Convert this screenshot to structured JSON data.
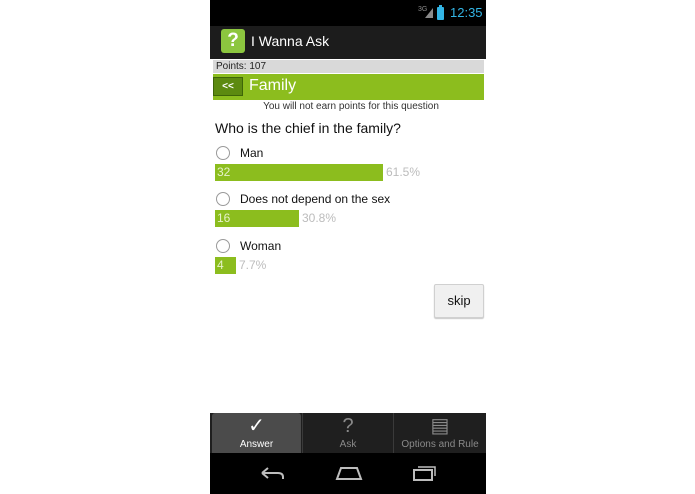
{
  "status_bar": {
    "network": "3G",
    "time": "12:35"
  },
  "app": {
    "title": "I Wanna Ask",
    "icon": "question-mark-icon",
    "icon_glyph": "?"
  },
  "points": {
    "text": "Points:  107"
  },
  "category": {
    "back_label": "<<",
    "title": "Family"
  },
  "notice": "You will not earn points for this question",
  "question": "Who is the chief in the family?",
  "options": [
    {
      "label": "Man",
      "count": "32",
      "percent": "61.5%",
      "fraction": 0.615
    },
    {
      "label": "Does not depend on the sex",
      "count": "16",
      "percent": "30.8%",
      "fraction": 0.308
    },
    {
      "label": "Woman",
      "count": "4",
      "percent": "7.7%",
      "fraction": 0.077
    }
  ],
  "skip_label": "skip",
  "tabs": [
    {
      "label": "Answer",
      "icon": "check-icon",
      "glyph": "✓",
      "active": true
    },
    {
      "label": "Ask",
      "icon": "question-icon",
      "glyph": "?",
      "active": false
    },
    {
      "label": "Options and Rule",
      "icon": "list-icon",
      "glyph": "▤",
      "active": false
    }
  ],
  "nav": [
    "back-icon",
    "home-icon",
    "recent-apps-icon"
  ],
  "colors": {
    "accent": "#8cbd1e",
    "back_button": "#5c8a10",
    "status_icons": "#33b5e5"
  }
}
